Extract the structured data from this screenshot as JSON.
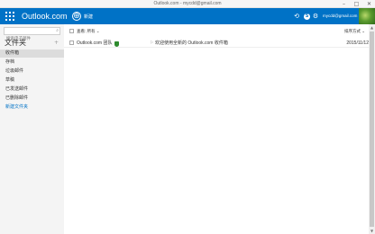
{
  "window": {
    "title": "Outlook.com - mycdd@gmail.com",
    "minimize_glyph": "–",
    "maximize_glyph": "□",
    "close_glyph": "✕"
  },
  "topbar": {
    "brand": "Outlook.com",
    "new_icon": "⊕",
    "new_label": "新建",
    "undo_icon": "⟲",
    "skype_icon": "S",
    "settings_icon": "⚙",
    "user_email": "mycdd@gmail.com",
    "accent_color": "#0072c6"
  },
  "sidebar": {
    "search_placeholder": "搜索电子邮件",
    "search_icon": "⌕",
    "folders_heading": "文件夹",
    "add_folder_icon": "+",
    "folders": [
      {
        "label": "收件箱",
        "selected": true
      },
      {
        "label": "存档",
        "selected": false
      },
      {
        "label": "垃圾邮件",
        "selected": false
      },
      {
        "label": "草稿",
        "selected": false
      },
      {
        "label": "已发送邮件",
        "selected": false
      },
      {
        "label": "已删除邮件",
        "selected": false
      }
    ],
    "new_folder_label": "新建文件夹"
  },
  "list": {
    "view_label": "查看: 所有 ⌄",
    "sort_label": "排序方式 ⌄",
    "messages": [
      {
        "sender": "Outlook.com 团队",
        "flag_icon": "⚐",
        "subject": "欢迎使用全新的 Outlook.com 收件箱",
        "date": "2015/11/12"
      }
    ]
  },
  "scrollbar": {
    "up_glyph": "▲",
    "down_glyph": "▼"
  }
}
